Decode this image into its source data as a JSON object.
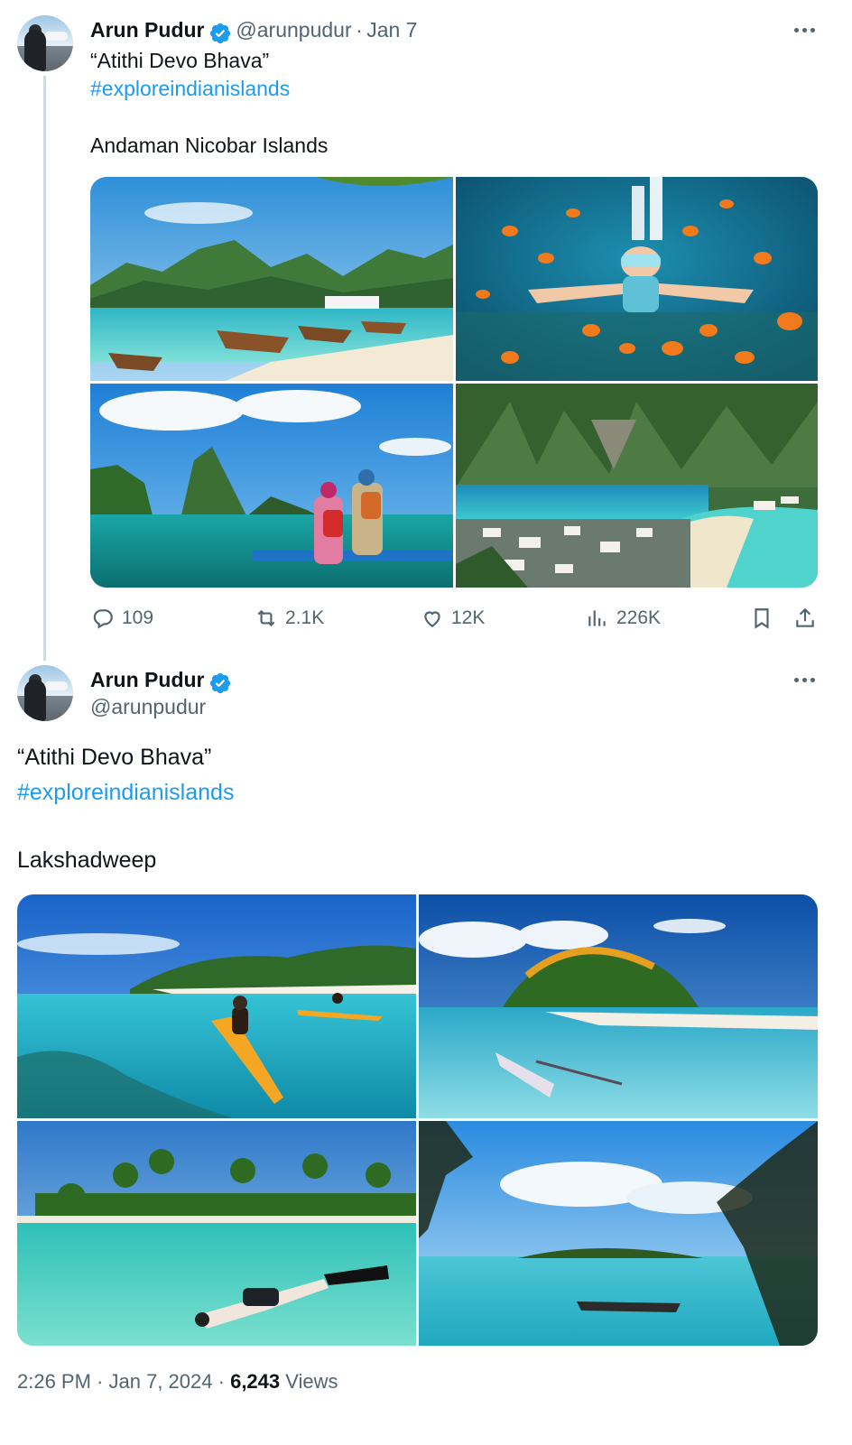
{
  "tweet1": {
    "name": "Arun Pudur",
    "handle": "@arunpudur",
    "sep": "·",
    "date": "Jan 7",
    "line1": "“Atithi Devo Bhava”",
    "hashtag": "#exploreindianislands",
    "place": "Andaman Nicobar Islands",
    "images": [
      "beach-boats",
      "snorkel-fish",
      "couple-cliffs",
      "bay-aerial"
    ],
    "actions": {
      "replies": "109",
      "retweets": "2.1K",
      "likes": "12K",
      "views": "226K"
    }
  },
  "tweet2": {
    "name": "Arun Pudur",
    "handle": "@arunpudur",
    "line1": "“Atithi Devo Bhava”",
    "hashtag": "#exploreindianislands",
    "place": "Lakshadweep",
    "images": [
      "kayak-lagoon",
      "palm-island",
      "snorkel-swimmer",
      "boat-palms"
    ],
    "footer": {
      "time": "2:26 PM",
      "sep1": "·",
      "date": "Jan 7, 2024",
      "sep2": "·",
      "views_count": "6,243",
      "views_label": "Views"
    }
  },
  "colors": {
    "link": "#1d9bf0",
    "muted": "#536471",
    "text": "#0f1419",
    "verified": "#1d9bf0"
  },
  "icons": [
    "verified-badge-icon",
    "more-icon",
    "reply-icon",
    "retweet-icon",
    "like-icon",
    "views-icon",
    "bookmark-icon",
    "share-icon"
  ]
}
